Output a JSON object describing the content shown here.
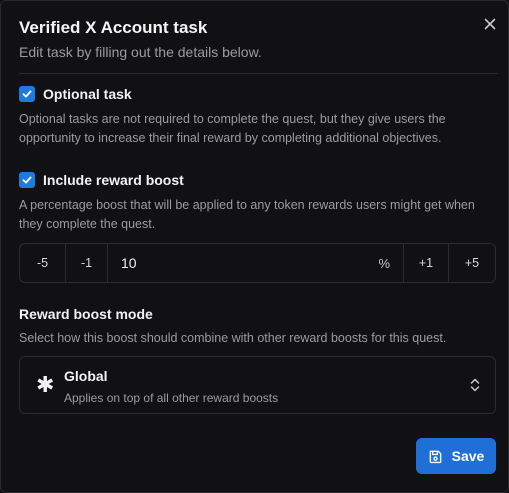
{
  "dialog": {
    "title": "Verified X Account task",
    "subtitle": "Edit task by filling out the details below."
  },
  "optional_task": {
    "checked": true,
    "label": "Optional task",
    "description": "Optional tasks are not required to complete the quest, but they give users the opportunity to increase their final reward by completing additional objectives."
  },
  "reward_boost": {
    "checked": true,
    "label": "Include reward boost",
    "description": "A percentage boost that will be applied to any token rewards users might get when they complete the quest.",
    "stepper": {
      "minus5": "-5",
      "minus1": "-1",
      "value": "10",
      "unit": "%",
      "plus1": "+1",
      "plus5": "+5"
    }
  },
  "boost_mode": {
    "title": "Reward boost mode",
    "description": "Select how this boost should combine with other reward boosts for this quest.",
    "selected": {
      "icon": "asterisk-icon",
      "label": "Global",
      "description": "Applies on top of all other reward boosts"
    }
  },
  "footer": {
    "save_label": "Save"
  },
  "colors": {
    "accent": "#1f6fd6",
    "checkbox": "#1f7ae0",
    "background": "#111113"
  }
}
